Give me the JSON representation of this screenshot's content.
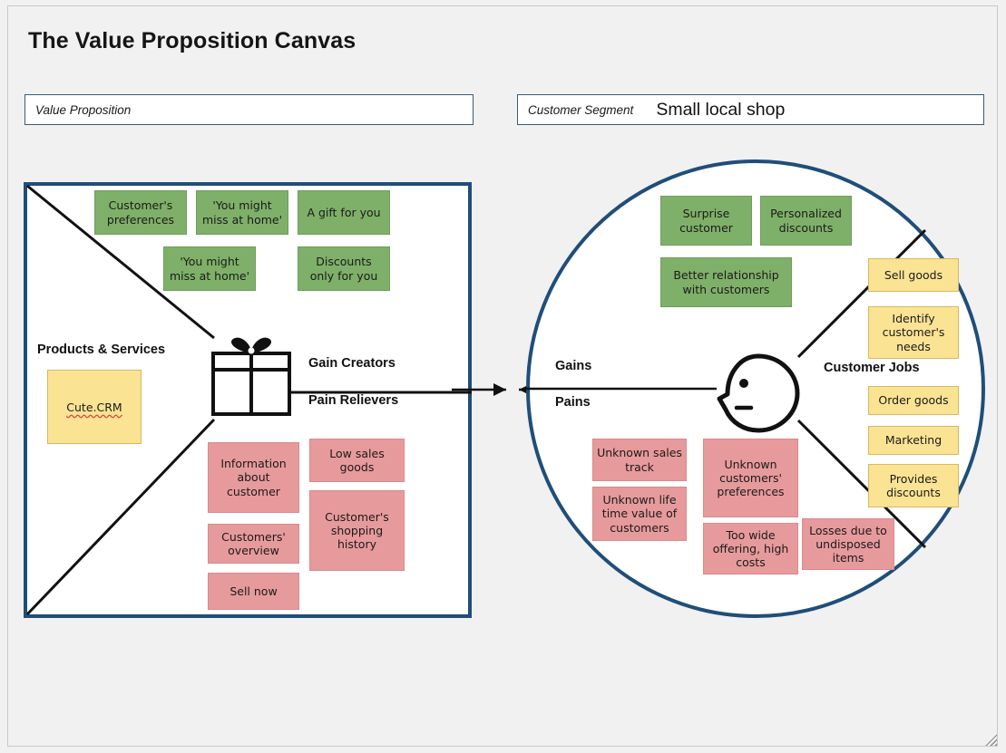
{
  "page": {
    "title": "The Value Proposition Canvas",
    "background_color": "#f1f1f1",
    "accent_color": "#1f4e79",
    "green_color": "#7fb069",
    "pink_color": "#e79a9c",
    "yellow_color": "#fbe394"
  },
  "value_proposition_field": {
    "label": "Value Proposition",
    "value": ""
  },
  "customer_segment_field": {
    "label": "Customer Segment",
    "value": "Small local shop"
  },
  "value_proposition": {
    "labels": {
      "products_services": "Products & Services",
      "gain_creators": "Gain Creators",
      "pain_relievers": "Pain Relievers"
    },
    "products_services": [
      {
        "text": "Cute.CRM",
        "color": "yellow",
        "spellcheck_underline": true
      }
    ],
    "gain_creators": [
      {
        "text": "Customer's\npreferences",
        "color": "green"
      },
      {
        "text": "'You might\nmiss at home'",
        "color": "green"
      },
      {
        "text": "A gift for you",
        "color": "green"
      },
      {
        "text": "'You might\nmiss at home'",
        "color": "green"
      },
      {
        "text": "Discounts\nonly for you",
        "color": "green"
      }
    ],
    "pain_relievers": [
      {
        "text": "Information\nabout\ncustomer",
        "color": "pink"
      },
      {
        "text": "Low sales\ngoods",
        "color": "pink"
      },
      {
        "text": "Customers'\noverview",
        "color": "pink"
      },
      {
        "text": "Customer's\nshopping\nhistory",
        "color": "pink"
      },
      {
        "text": "Sell now",
        "color": "pink"
      }
    ]
  },
  "customer_segment": {
    "labels": {
      "gains": "Gains",
      "pains": "Pains",
      "customer_jobs": "Customer Jobs"
    },
    "gains": [
      {
        "text": "Surprise\ncustomer",
        "color": "green"
      },
      {
        "text": "Personalized\ndiscounts",
        "color": "green"
      },
      {
        "text": "Better relationship\nwith customers",
        "color": "green"
      }
    ],
    "customer_jobs": [
      {
        "text": "Sell goods",
        "color": "yellow"
      },
      {
        "text": "Identify\ncustomer's\nneeds",
        "color": "yellow"
      },
      {
        "text": "Order goods",
        "color": "yellow"
      },
      {
        "text": "Marketing",
        "color": "yellow"
      },
      {
        "text": "Provides\ndiscounts",
        "color": "yellow"
      }
    ],
    "pains": [
      {
        "text": "Unknown sales\ntrack",
        "color": "pink"
      },
      {
        "text": "Unknown life\ntime value of\ncustomers",
        "color": "pink"
      },
      {
        "text": "Unknown\ncustomers'\npreferences",
        "color": "pink"
      },
      {
        "text": "Too wide\noffering, high\ncosts",
        "color": "pink"
      },
      {
        "text": "Losses due to\nundisposed\nitems",
        "color": "pink"
      }
    ]
  },
  "icons": {
    "gift": "gift-icon",
    "head": "customer-head-icon",
    "resize_grip": "resize-grip-icon"
  }
}
